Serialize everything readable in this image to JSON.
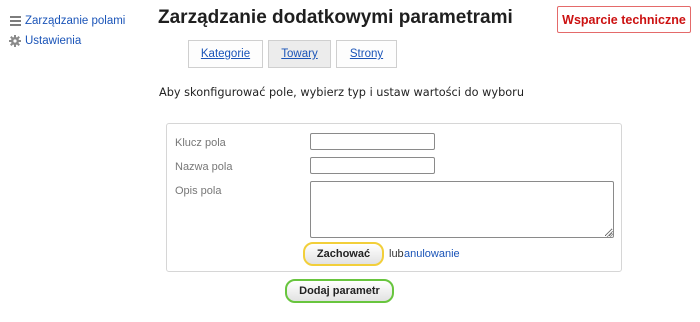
{
  "sidebar": {
    "items": [
      {
        "label": "Zarządzanie polami",
        "icon": "list-icon"
      },
      {
        "label": "Ustawienia",
        "icon": "gear-icon"
      }
    ]
  },
  "header": {
    "title": "Zarządzanie dodatkowymi parametrami",
    "support_label": "Wsparcie techniczne"
  },
  "tabs": [
    {
      "label": "Kategorie",
      "active": false
    },
    {
      "label": "Towary",
      "active": true
    },
    {
      "label": "Strony",
      "active": false
    }
  ],
  "instructions": "Aby skonfigurować pole, wybierz typ i ustaw wartości do wyboru",
  "form": {
    "key_label": "Klucz pola",
    "key_value": "",
    "name_label": "Nazwa pola",
    "name_value": "",
    "desc_label": "Opis pola",
    "desc_value": "",
    "save_label": "Zachować",
    "or_text": "lub",
    "cancel_label": "anulowanie"
  },
  "add_button_label": "Dodaj parametr",
  "colors": {
    "link": "#1a54b8",
    "support": "#cc1111",
    "save_border": "#f2cf3a",
    "add_border": "#68c53e"
  }
}
